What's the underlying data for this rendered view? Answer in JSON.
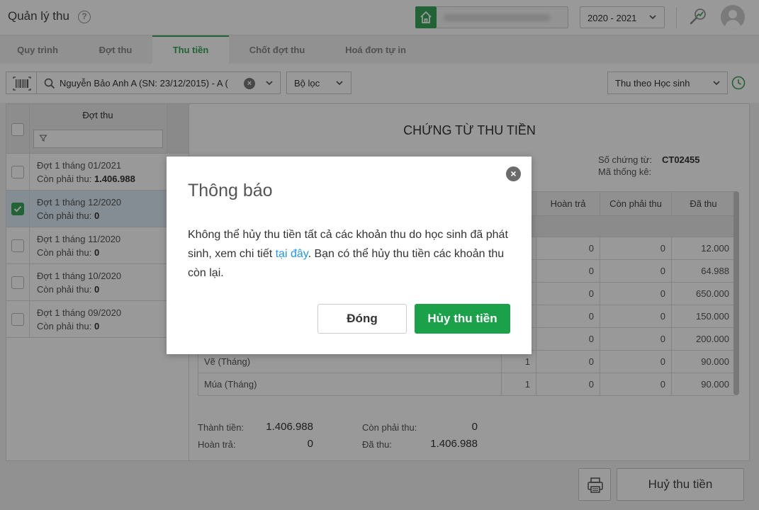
{
  "header": {
    "app_title": "Quản lý thu",
    "help_label": "?",
    "school_year": "2020 - 2021"
  },
  "tabs": [
    {
      "label": "Quy trình"
    },
    {
      "label": "Đợt thu"
    },
    {
      "label": "Thu tiền"
    },
    {
      "label": "Chốt đợt thu"
    },
    {
      "label": "Hoá đơn tự in"
    }
  ],
  "toolbar": {
    "search_value": "Nguyễn Bảo Anh A (SN: 23/12/2015) - A (",
    "filter_label": "Bộ lọc",
    "mode_label": "Thu theo Học sinh"
  },
  "rounds_panel": {
    "header": "Đợt thu",
    "due_label": "Còn phải thu:",
    "items": [
      {
        "name": "Đợt 1 tháng 01/2021",
        "due": "1.406.988",
        "checked": false,
        "selected": false
      },
      {
        "name": "Đợt 1 tháng 12/2020",
        "due": "0",
        "checked": true,
        "selected": true
      },
      {
        "name": "Đợt 1 tháng 11/2020",
        "due": "0",
        "checked": false,
        "selected": false
      },
      {
        "name": "Đợt 1 tháng 10/2020",
        "due": "0",
        "checked": false,
        "selected": false
      },
      {
        "name": "Đợt 1 tháng 09/2020",
        "due": "0",
        "checked": false,
        "selected": false
      }
    ]
  },
  "voucher": {
    "title": "CHỨNG TỪ THU TIỀN",
    "voucher_no_label": "Số chứng từ:",
    "voucher_no": "CT02455",
    "stat_code_label": "Mã thống kê:",
    "columns": [
      "Hoàn trả",
      "Còn phải thu",
      "Đã thu"
    ],
    "rows": [
      {
        "name": "",
        "qty": "",
        "refund": "0",
        "remaining": "0",
        "paid": "12.000"
      },
      {
        "name": "",
        "qty": "",
        "refund": "0",
        "remaining": "0",
        "paid": "64.988"
      },
      {
        "name": "",
        "qty": "",
        "refund": "0",
        "remaining": "0",
        "paid": "650.000"
      },
      {
        "name": "",
        "qty": "",
        "refund": "0",
        "remaining": "0",
        "paid": "150.000"
      },
      {
        "name": "",
        "qty": "",
        "refund": "0",
        "remaining": "0",
        "paid": "200.000"
      },
      {
        "name": "Vẽ (Tháng)",
        "qty": "1",
        "refund": "0",
        "remaining": "0",
        "paid": "90.000"
      },
      {
        "name": "Múa (Tháng)",
        "qty": "1",
        "refund": "0",
        "remaining": "0",
        "paid": "90.000"
      }
    ],
    "summary": {
      "total_label": "Thành tiền:",
      "total": "1.406.988",
      "refund_label": "Hoàn trả:",
      "refund": "0",
      "remaining_label": "Còn phải thu:",
      "remaining": "0",
      "paid_label": "Đã thu:",
      "paid": "1.406.988"
    }
  },
  "bottom": {
    "cancel_collect_label": "Huỷ thu tiền"
  },
  "modal": {
    "title": "Thông báo",
    "message_part1": "Không thể hủy thu tiền tất cả các khoản thu do học sinh đã phát sinh, xem chi tiết ",
    "link_text": "tại đây",
    "message_part2": ". Bạn có thể hủy thu tiền các khoản thu còn lại.",
    "close_button": "Đóng",
    "confirm_button": "Hủy thu tiền"
  },
  "colors": {
    "accent": "#3aa55a",
    "confirm": "#1aa14a",
    "link": "#2196f3",
    "selected_row": "#dcebf7"
  }
}
